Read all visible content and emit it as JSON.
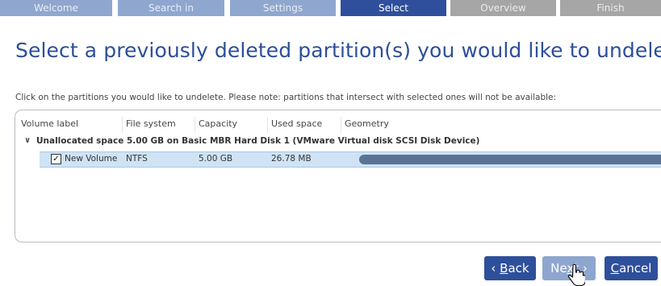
{
  "steps": [
    "Welcome",
    "Search in",
    "Settings",
    "Select",
    "Overview",
    "Finish"
  ],
  "active_step": "Select",
  "title": "Select a previously deleted partition(s) you would like to undelete.",
  "instructions": "Click on the partitions you would like to undelete. Please note: partitions that intersect with selected ones will not be available:",
  "table": {
    "headers": {
      "volume_label": "Volume label",
      "file_system": "File system",
      "capacity": "Capacity",
      "used_space": "Used space",
      "geometry": "Geometry"
    },
    "group": {
      "label": "Unallocated space 5.00 GB on Basic MBR Hard Disk 1 (VMware Virtual disk SCSI Disk Device)",
      "expanded": true
    },
    "rows": [
      {
        "checked": true,
        "volume_label": "New Volume",
        "file_system": "NTFS",
        "capacity": "5.00 GB",
        "used_space": "26.78 MB"
      }
    ]
  },
  "buttons": {
    "back": {
      "arrow": "‹",
      "mnemonic": "B",
      "rest": "ack"
    },
    "next": {
      "prefix": "Ne",
      "mnemonic": "x",
      "rest": "t",
      "arrow": "›"
    },
    "cancel": {
      "mnemonic": "C",
      "rest": "ancel"
    }
  },
  "colors": {
    "accent": "#2e4f9b",
    "step_inactive": "#8fa7cf",
    "step_future": "#a6a6a6",
    "row_selected": "#cfe3f5",
    "geometry_bar": "#5a7395"
  },
  "icons": [
    "chevron-down-icon",
    "checkbox-checked-icon",
    "hand-cursor-icon"
  ]
}
